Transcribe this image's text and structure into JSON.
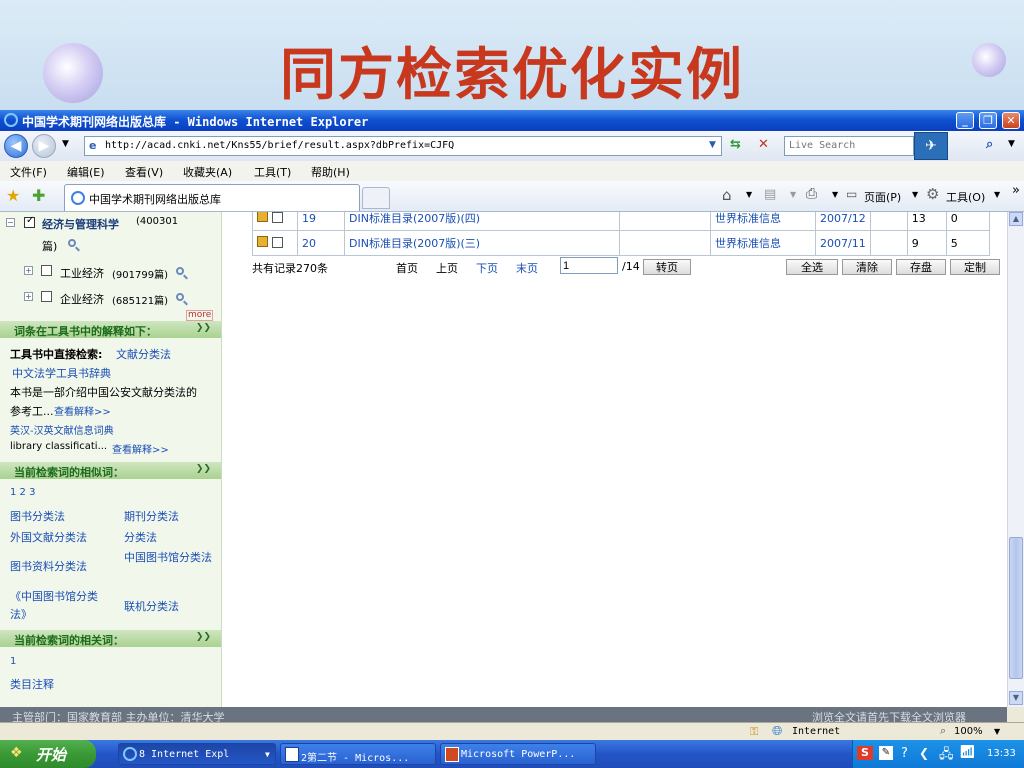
{
  "slide": {
    "title": "同方检索优化实例"
  },
  "window": {
    "title": "中国学术期刊网络出版总库 - Windows Internet Explorer",
    "controls": [
      "_",
      "❐",
      "✕"
    ]
  },
  "address": {
    "url": "http://acad.cnki.net/Kns55/brief/result.aspx?dbPrefix=CJFQ",
    "search_placeholder": "Live Search"
  },
  "menu": [
    "文件(F)",
    "编辑(E)",
    "查看(V)",
    "收藏夹(A)",
    "工具(T)",
    "帮助(H)"
  ],
  "tab": {
    "label": "中国学术期刊网络出版总库"
  },
  "favtools": {
    "page": "页面(P)",
    "tools": "工具(O)",
    "more": "»"
  },
  "sidebar": {
    "top_category": "经济与管理科学",
    "top_count": "(400301",
    "top_count_suffix": "篇)",
    "subcats": [
      {
        "label": "工业经济",
        "count": "(901799篇)"
      },
      {
        "label": "企业经济",
        "count": "(685121篇)"
      }
    ],
    "more": "more",
    "sec1_title": "词条在工具书中的解释如下：",
    "direct_search_label": "工具书中直接检索:",
    "direct_search_link": "文献分类法",
    "dict1": "中文法学工具书辞典",
    "dict1_desc": "本书是一部介绍中国公安文献分类法的",
    "dict1_desc2": "参考工...",
    "see_more": "查看解释>>",
    "dict2": "英汉-汉英文献信息词典",
    "dict2_desc": "library classificati...",
    "sec2_title": "当前检索词的相似词：",
    "pages": "1 2 3",
    "similar": [
      "图书分类法",
      "期刊分类法",
      "外国文献分类法",
      "分类法",
      "图书资料分类法",
      "中国图书馆分类法",
      "《中国图书馆分类法》",
      "联机分类法"
    ],
    "sec3_title": "当前检索词的相关词：",
    "related_page": "1",
    "related": [
      "类目注释"
    ]
  },
  "results": {
    "rows": [
      {
        "num": "19",
        "title": "DIN标准目录(2007版)(四)",
        "source": "世界标准信息",
        "date": "2007/12",
        "cite": "13",
        "dl": "0"
      },
      {
        "num": "20",
        "title": "DIN标准目录(2007版)(三)",
        "source": "世界标准信息",
        "date": "2007/11",
        "cite": "9",
        "dl": "5"
      }
    ],
    "total": "共有记录270条",
    "first": "首页",
    "prev": "上页",
    "next": "下页",
    "last": "末页",
    "page_value": "1",
    "page_total": "/14",
    "go": "转页",
    "select_all": "全选",
    "clear": "清除",
    "save": "存盘",
    "custom": "定制"
  },
  "footer": {
    "left": "主管部门：国家教育部  主办单位：清华大学",
    "right": "浏览全文请首先下载全文浏览器"
  },
  "status": {
    "zone": "Internet",
    "zoom": "100%"
  },
  "taskbar": {
    "start": "开始",
    "items": [
      "8 Internet Expl",
      "2第二节 - Micros...",
      "Microsoft PowerP..."
    ],
    "clock": "13:33"
  }
}
